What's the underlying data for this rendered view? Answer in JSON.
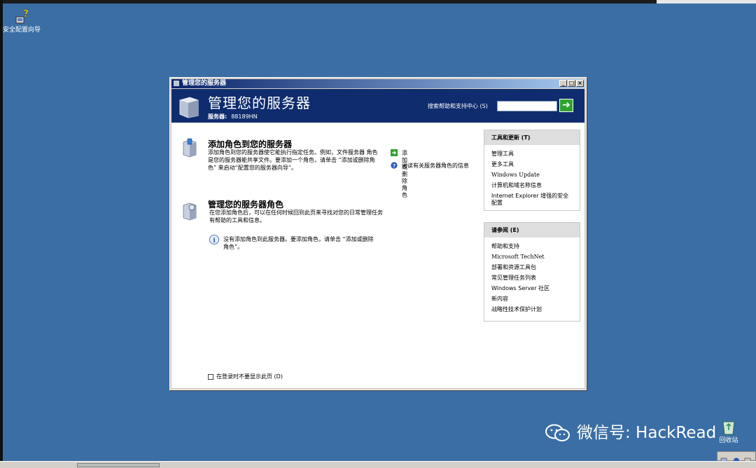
{
  "desktop": {
    "icons": [
      {
        "label": "安全配置向导"
      },
      {
        "label": "回收站"
      }
    ]
  },
  "window": {
    "title": "管理您的服务器",
    "controls": {
      "minimize": "_",
      "maximize": "□",
      "close": "×"
    },
    "banner": {
      "title": "管理您的服务器",
      "server_label": "服务器:",
      "server_name": "88189HN",
      "search_label": "搜索帮助和支持中心 (S)",
      "search_value": "",
      "go_icon": "arrow-right-icon"
    },
    "sections": [
      {
        "title": "添加角色到您的服务器",
        "description": "添加角色到您的服务器使它能执行指定任务。例如，文件服务器 角色是您的服务器能共享文件。要添加一个角色，请单击 “添加或删除角色” 来启动“配置您的服务器向导”。"
      },
      {
        "title": "管理您的服务器角色",
        "description": "在您添加角色后，可以在任何时候回到此页来寻找对您的日常管理任务有帮助的工具和信息。",
        "info": "没有添加角色到此服务器。要添加角色，请单击 “添加或删除角色”。"
      }
    ],
    "actions": [
      {
        "label": "添加或删除角色",
        "icon": "green-arrow-icon"
      },
      {
        "label": "阅读有关服务器角色的信息",
        "icon": "help-icon"
      }
    ],
    "panels": [
      {
        "title": "工具和更新 (T)",
        "items": [
          "管理工具",
          "更多工具",
          "Windows Update",
          "计算机和域名称信息",
          "Internet Explorer 增强的安全配置"
        ]
      },
      {
        "title": "请参阅 (E)",
        "items": [
          "帮助和支持",
          "Microsoft TechNet",
          "部署和资源工具包",
          "常见管理任务列表",
          "Windows Server 社区",
          "新内容",
          "战略性技术保护计划"
        ]
      }
    ],
    "dont_show": {
      "label": "在登录时不要显示此页 (D)",
      "checked": false
    }
  },
  "watermark": {
    "text": "微信号: HackRead"
  }
}
